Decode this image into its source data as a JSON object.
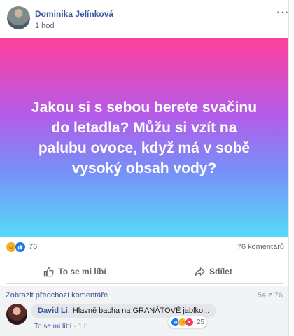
{
  "post": {
    "author": "Dominika Jelínková",
    "time": "1 hod",
    "more_label": "···",
    "text": "Jakou si s sebou berete svačinu do letadla? Můžu si vzít na palubu ovoce, když má v sobě vysoký obsah vody?",
    "reaction_count": "76",
    "comment_count": "76 komentářů"
  },
  "actions": {
    "like_label": "To se mi líbí",
    "share_label": "Sdílet"
  },
  "comments": {
    "previous_label": "Zobrazit předchozí komentáře",
    "counter": "54 z 76",
    "items": [
      {
        "author": "David Li",
        "text": "Hlavně bacha na GRANÁTOVÉ jablko...",
        "like_label": "To se mi líbí",
        "time": "1 h",
        "reaction_count": "25"
      }
    ]
  },
  "colors": {
    "link_blue": "#385898",
    "banner_top": "#ff3f9a",
    "banner_bottom": "#55dcf7"
  }
}
